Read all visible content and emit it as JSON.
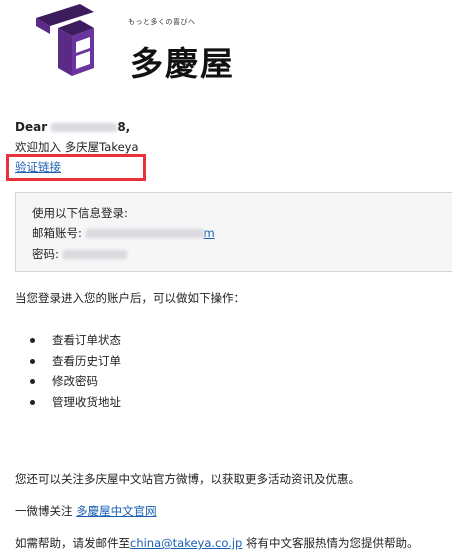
{
  "brand": {
    "tagline": "もっと多くの喜びへ",
    "name": "多慶屋",
    "logo_colors": {
      "purple": "#5b2a86",
      "dark_purple": "#3d1c5e"
    }
  },
  "email": {
    "greeting_prefix": "Dear",
    "greeting_suffix": "8,",
    "welcome": "欢迎加入 多庆屋Takeya",
    "verify_link": "验证链接",
    "login_info": {
      "title": "使用以下信息登录:",
      "email_label": "邮箱账号:",
      "email_value_tail": "m",
      "password_label": "密码:"
    },
    "after_login": "当您登录进入您的账户后，可以做如下操作：",
    "operations": [
      "查看订单状态",
      "查看历史订单",
      "修改密码",
      "管理收货地址"
    ],
    "weibo_text": "您还可以关注多庆屋中文站官方微博，以获取更多活动资讯及优惠。",
    "follow_prefix": "一微博关注",
    "follow_link": "多慶屋中文官网",
    "help_prefix": "如需帮助，请发邮件至",
    "help_email": "china@takeya.co.jp",
    "help_suffix": " 将有中文客服热情为您提供帮助。"
  },
  "colors": {
    "link": "#1a5fb4",
    "highlight": "#e8323c",
    "box_bg": "#f6f6f6"
  }
}
